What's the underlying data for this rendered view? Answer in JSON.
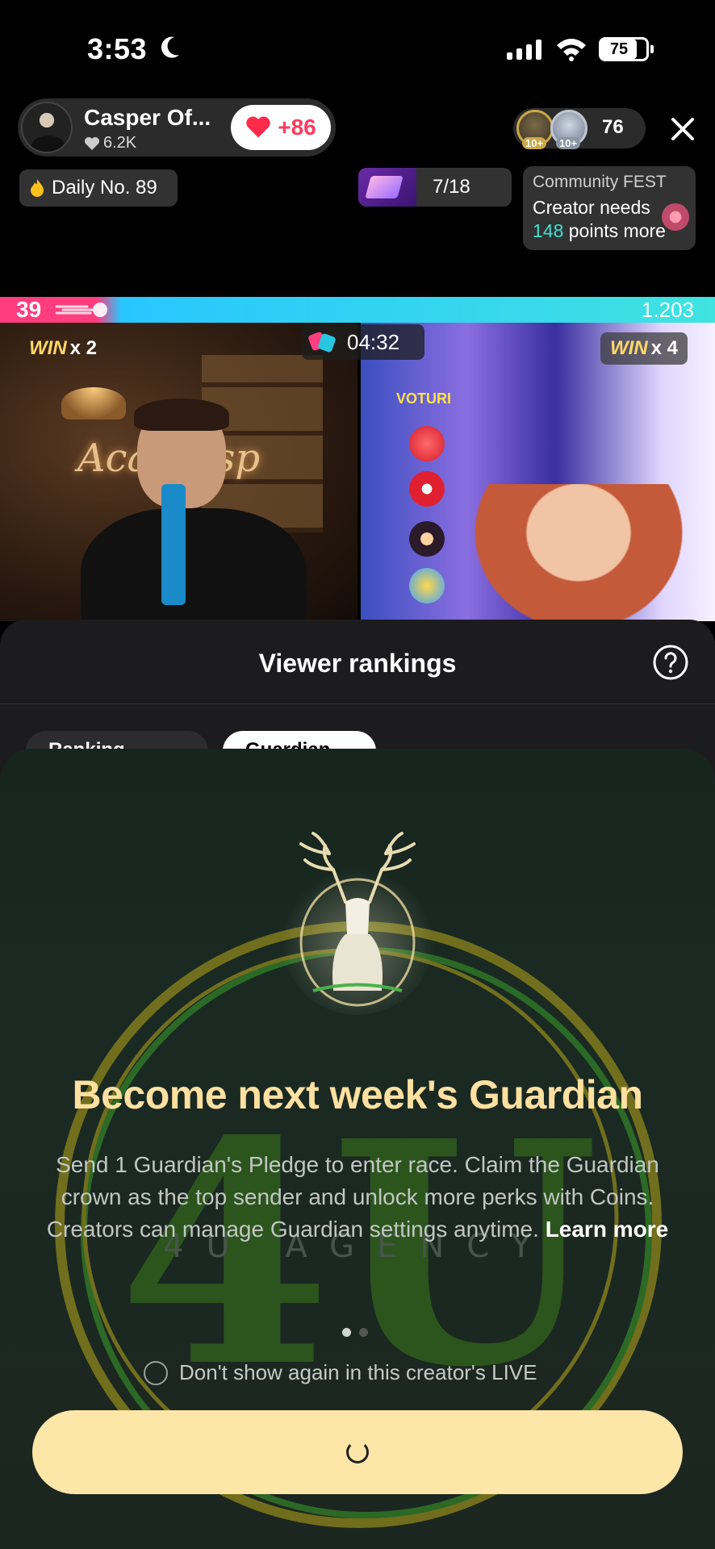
{
  "status_bar": {
    "time": "3:53",
    "battery": "75"
  },
  "host": {
    "name": "Casper Of...",
    "likes": "6.2K",
    "like_button": "+86"
  },
  "viewers": {
    "count": "76",
    "badge_1": "10+",
    "badge_2": "10+"
  },
  "daily": {
    "label": "Daily No. 89"
  },
  "gift_goal": {
    "progress": "7/18"
  },
  "community_fest": {
    "title": "Community FEST",
    "line1": "Creator needs",
    "points_number": "148",
    "points_suffix": " points more"
  },
  "battle": {
    "left_score": "39",
    "right_score": "1.203",
    "timer": "04:32",
    "left_win": "WIN",
    "left_win_count": "x 2",
    "right_win": "WIN",
    "right_win_count": "x 4",
    "neon_text": "Aca Casp",
    "votes_label": "VOTURI"
  },
  "sheet": {
    "title": "Viewer rankings",
    "tab_ranking": "Ranking",
    "tab_guardian": "Guardian"
  },
  "guardian_modal": {
    "heading": "Become next week's Guardian",
    "body": "Send 1 Guardian's Pledge to enter race. Claim the Guardian crown as the top sender and unlock more perks with Coins. Creators can manage Guardian settings anytime.",
    "learn_more": "Learn more",
    "dont_show": "Don't show again in this creator's LIVE",
    "watermark_text": "4U AGENCY"
  },
  "colors": {
    "accent_pink": "#ff3d7f",
    "accent_cyan": "#3fe3e0",
    "heading_gold": "#ffe0a0",
    "cta_bg": "#fde6a8"
  }
}
